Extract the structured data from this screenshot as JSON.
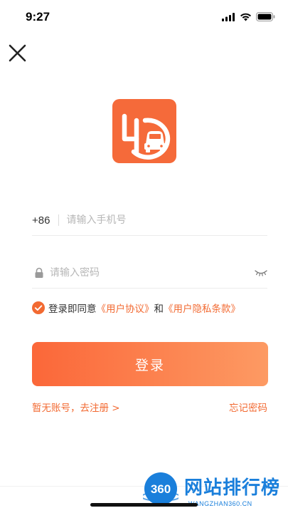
{
  "status_bar": {
    "time": "9:27",
    "icons": [
      "cellular-signal-icon",
      "wifi-icon",
      "battery-icon"
    ]
  },
  "header": {
    "close_icon": "close-icon"
  },
  "logo": {
    "name": "app-logo",
    "color": "#f56a3a"
  },
  "form": {
    "country_code": "+86",
    "phone_placeholder": "请输入手机号",
    "password_placeholder": "请输入密码",
    "lock_icon": "lock-icon",
    "toggle_icon": "eye-closed-icon"
  },
  "agreement": {
    "checked": true,
    "prefix": "登录即同意",
    "user_agreement": "《用户协议》",
    "conjunction": "和",
    "privacy_policy": "《用户隐私条款》"
  },
  "actions": {
    "login_label": "登录",
    "register_label": "暂无账号，去注册 >",
    "forgot_label": "忘记密码"
  },
  "colors": {
    "accent": "#f26a32",
    "button_gradient_start": "#fb6739",
    "button_gradient_end": "#fd9a63",
    "watermark_blue": "#1a7fdb"
  },
  "watermark": {
    "badge_text": "360",
    "title": "网站排行榜",
    "subtitle": "WANGZHAN360.CN"
  }
}
